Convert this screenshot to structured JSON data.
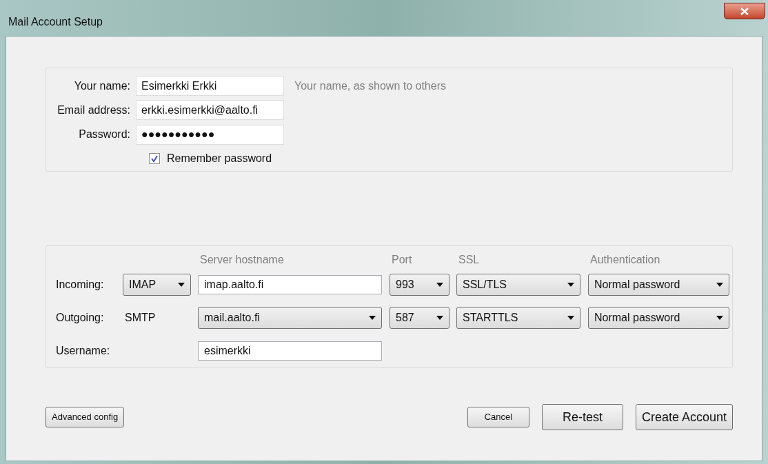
{
  "window": {
    "title": "Mail Account Setup"
  },
  "identity": {
    "fields": [
      {
        "label": "Your name:",
        "value": "Esimerkki Erkki",
        "hint": "Your name, as shown to others"
      },
      {
        "label": "Email address:",
        "value": "erkki.esimerkki@aalto.fi"
      },
      {
        "label": "Password:",
        "value": "●●●●●●●●●●●"
      }
    ],
    "remember": {
      "label": "Remember password",
      "checked": true
    }
  },
  "server": {
    "headers": [
      "Server hostname",
      "Port",
      "SSL",
      "Authentication"
    ],
    "rows": [
      {
        "label": "Incoming:",
        "cells": [
          {
            "kind": "select",
            "value": "IMAP"
          },
          {
            "kind": "input",
            "value": "imap.aalto.fi"
          },
          {
            "kind": "select",
            "value": "993"
          },
          {
            "kind": "select",
            "value": "SSL/TLS"
          },
          {
            "kind": "select",
            "value": "Normal password"
          }
        ]
      },
      {
        "label": "Outgoing:",
        "cells": [
          {
            "kind": "text",
            "value": "SMTP"
          },
          {
            "kind": "select",
            "value": "mail.aalto.fi"
          },
          {
            "kind": "select",
            "value": "587"
          },
          {
            "kind": "select",
            "value": "STARTTLS"
          },
          {
            "kind": "select",
            "value": "Normal password"
          }
        ]
      },
      {
        "label": "Username:",
        "cells": [
          {
            "kind": "empty"
          },
          {
            "kind": "input",
            "value": "esimerkki"
          }
        ]
      }
    ]
  },
  "buttons": {
    "left": [
      {
        "label": "Advanced config",
        "kind": "small"
      }
    ],
    "right": [
      {
        "label": "Cancel",
        "kind": "small"
      },
      {
        "label": "Re-test",
        "kind": "large"
      },
      {
        "label": "Create Account",
        "kind": "large"
      }
    ]
  }
}
